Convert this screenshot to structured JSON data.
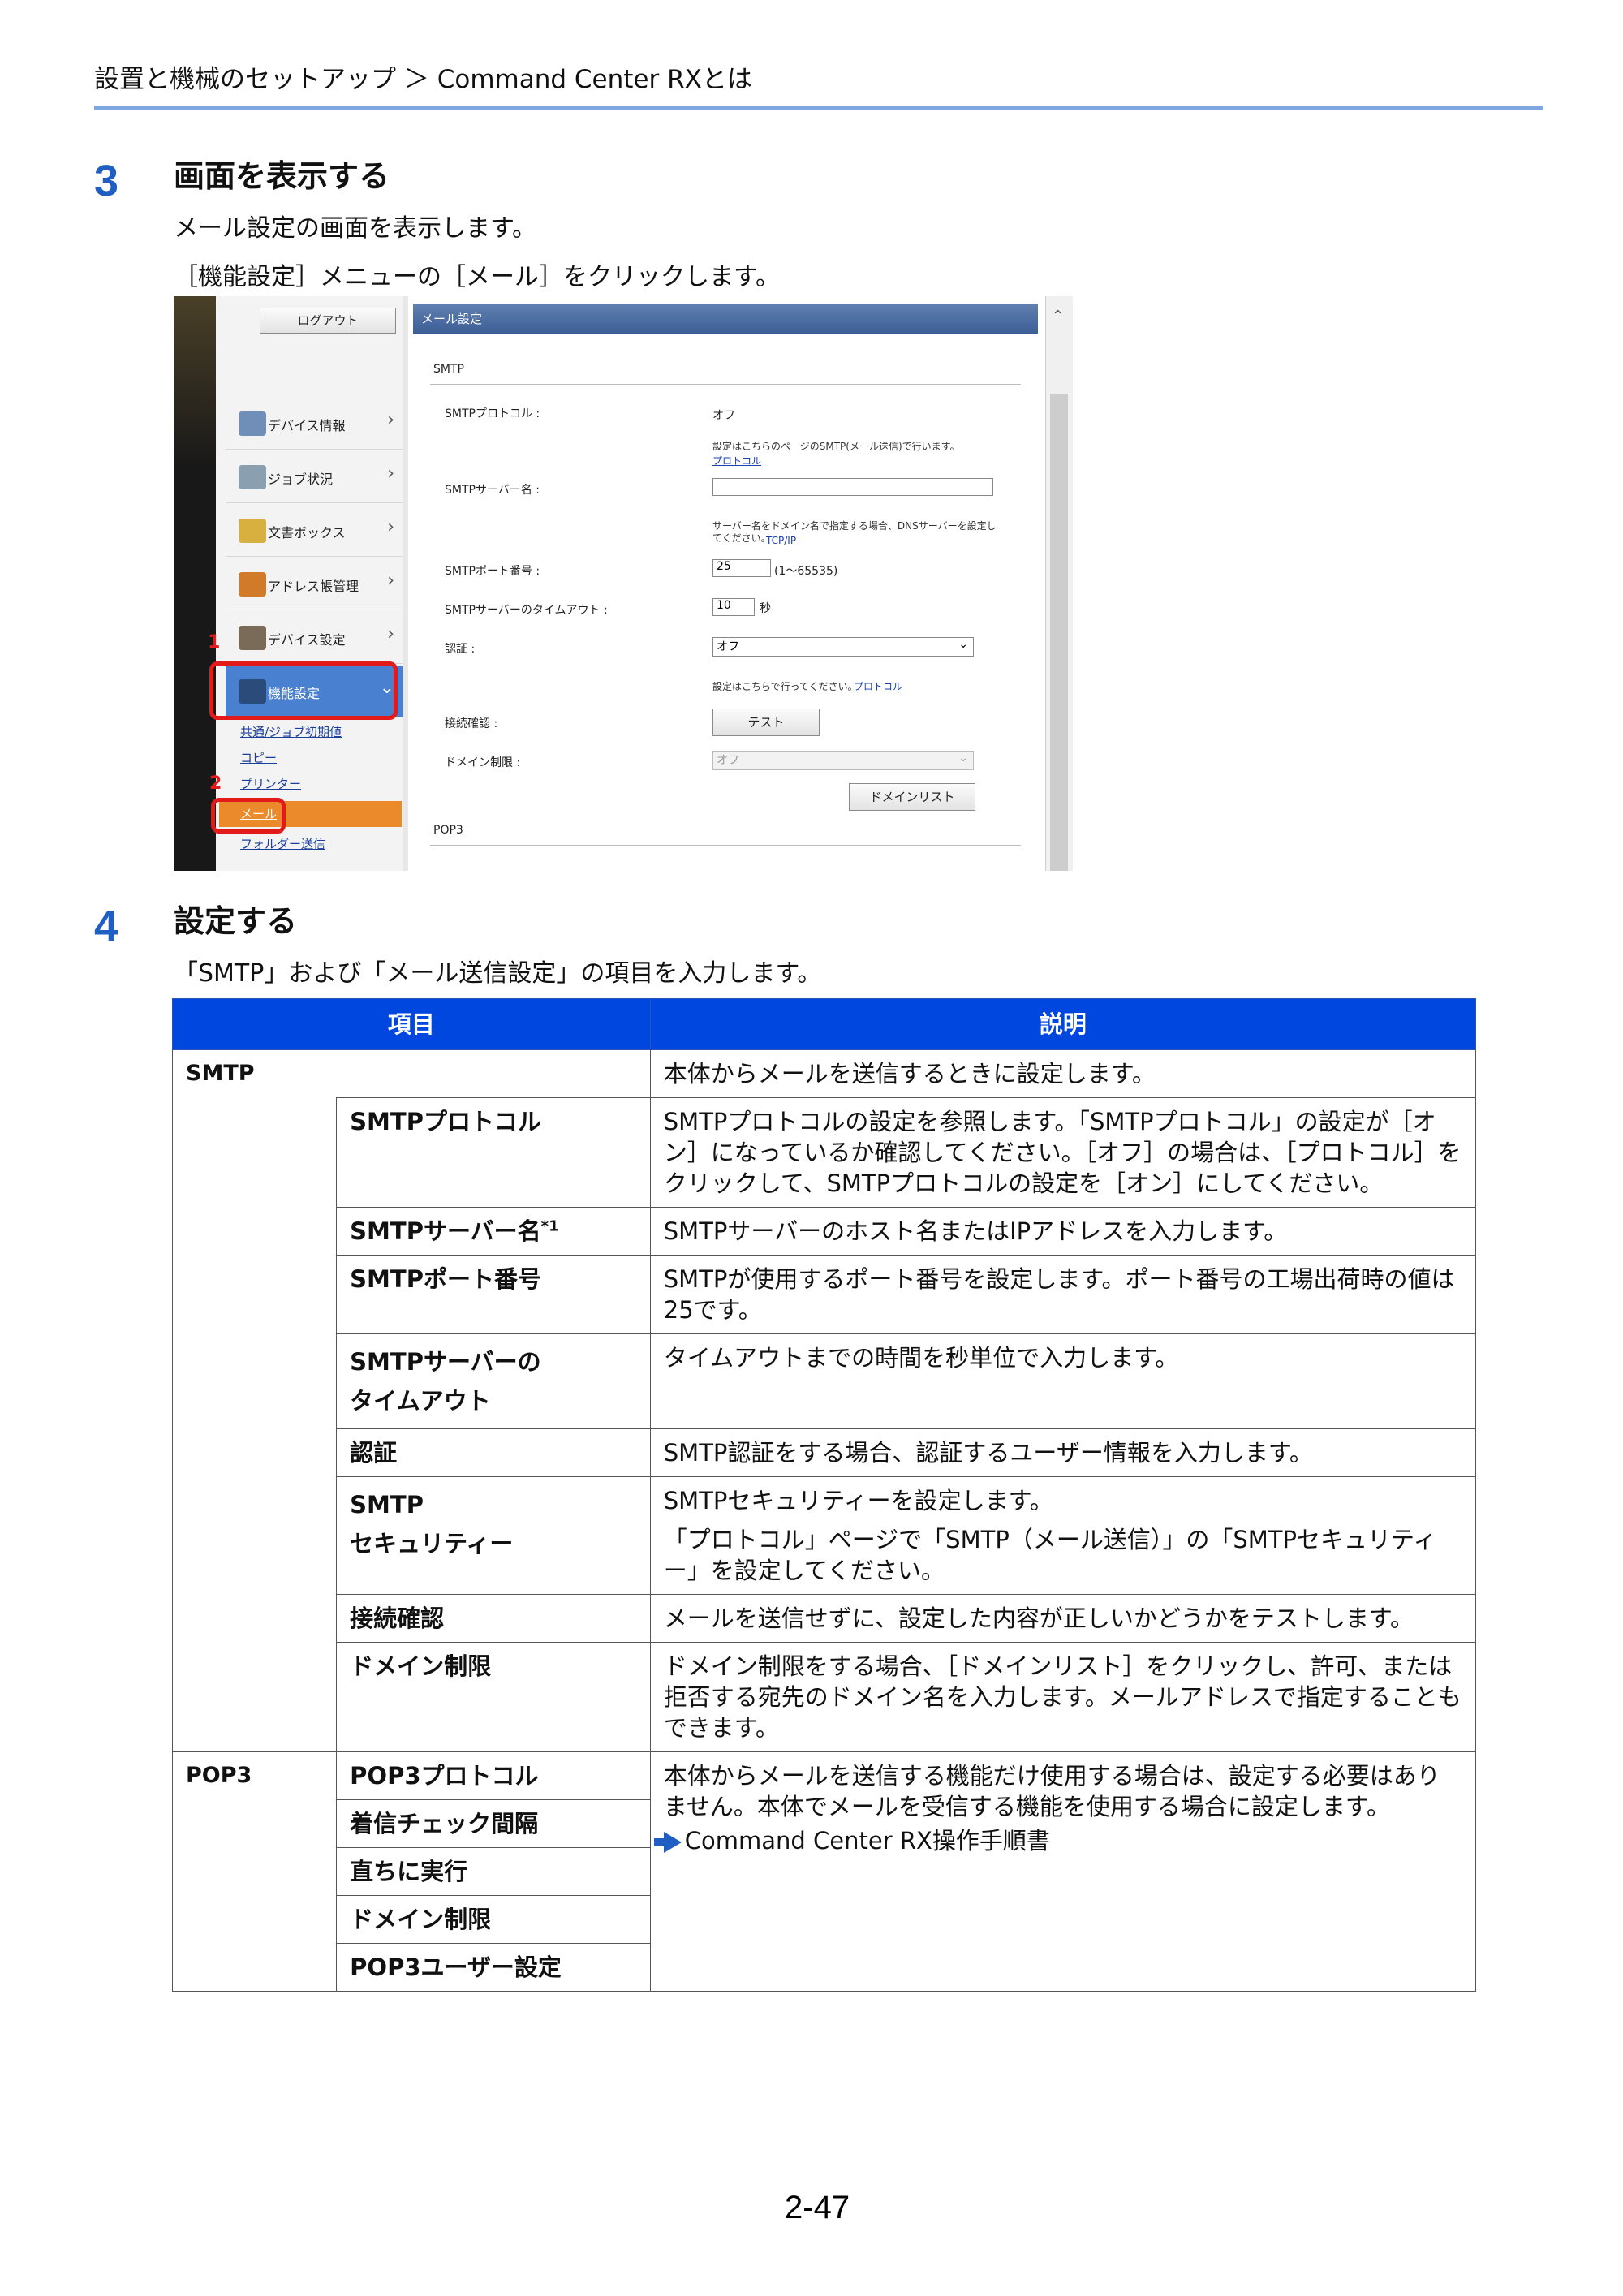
{
  "breadcrumb": "設置と機械のセットアップ ＞ Command Center RXとは",
  "step3": {
    "number": "3",
    "title": "画面を表示する",
    "line1": "メール設定の画面を表示します。",
    "line2": "［機能設定］メニューの［メール］をクリックします。"
  },
  "screenshot": {
    "logout_button": "ログアウト",
    "sidebar_items": [
      "デバイス情報",
      "ジョブ状況",
      "文書ボックス",
      "アドレス帳管理",
      "デバイス設定",
      "機能設定"
    ],
    "submenu_links": [
      "共通/ジョブ初期値",
      "コピー",
      "プリンター",
      "メール",
      "フォルダー送信"
    ],
    "callout_1": "1",
    "callout_2": "2",
    "panel_title": "メール設定",
    "section_smtp": "SMTP",
    "smtp_protocol_label": "SMTPプロトコル :",
    "smtp_protocol_value": "オフ",
    "smtp_protocol_note": "設定はこちらのページのSMTP(メール送信)で行います。",
    "smtp_protocol_link": "プロトコル",
    "smtp_server_label": "SMTPサーバー名 :",
    "smtp_server_note": "サーバー名をドメイン名で指定する場合、DNSサーバーを設定してください。",
    "smtp_server_link": "TCP/IP",
    "smtp_port_label": "SMTPポート番号 :",
    "smtp_port_value": "25",
    "smtp_port_range": "(1～65535)",
    "smtp_timeout_label": "SMTPサーバーのタイムアウト :",
    "smtp_timeout_value": "10",
    "smtp_timeout_unit": "秒",
    "auth_label": "認証 :",
    "auth_value": "オフ",
    "auth_note": "設定はこちらで行ってください。",
    "auth_link": "プロトコル",
    "conn_test_label": "接続確認 :",
    "test_button": "テスト",
    "domain_limit_label": "ドメイン制限 :",
    "domain_limit_value": "オフ",
    "domain_list_button": "ドメインリスト",
    "section_pop3": "POP3"
  },
  "step4": {
    "number": "4",
    "title": "設定する",
    "line1": "「SMTP」および「メール送信設定」の項目を入力します。"
  },
  "table": {
    "header_item": "項目",
    "header_desc": "説明",
    "smtp_group": "SMTP",
    "smtp_group_desc": "本体からメールを送信するときに設定します。",
    "rows": [
      {
        "name": "SMTPプロトコル",
        "desc": "SMTPプロトコルの設定を参照します。「SMTPプロトコル」の設定が［オン］になっているか確認してください。［オフ］の場合は、［プロトコル］をクリックして、SMTPプロトコルの設定を［オン］にしてください。"
      },
      {
        "name": "SMTPサーバー名",
        "sup": "*1",
        "desc": "SMTPサーバーのホスト名またはIPアドレスを入力します。"
      },
      {
        "name": "SMTPポート番号",
        "desc": "SMTPが使用するポート番号を設定します。ポート番号の工場出荷時の値は25です。"
      },
      {
        "name_l1": "SMTPサーバーの",
        "name_l2": "タイムアウト",
        "desc": "タイムアウトまでの時間を秒単位で入力します。"
      },
      {
        "name": "認証",
        "desc": "SMTP認証をする場合、認証するユーザー情報を入力します。"
      },
      {
        "name_l1": "SMTP",
        "name_l2": "セキュリティー",
        "desc_l1": "SMTPセキュリティーを設定します。",
        "desc_l2": "「プロトコル」ページで「SMTP（メール送信）」の「SMTPセキュリティー」を設定してください。"
      },
      {
        "name": "接続確認",
        "desc": "メールを送信せずに、設定した内容が正しいかどうかをテストします。"
      },
      {
        "name": "ドメイン制限",
        "desc": "ドメイン制限をする場合、［ドメインリスト］をクリックし、許可、または拒否する宛先のドメイン名を入力します。メールアドレスで指定することもできます。"
      }
    ],
    "pop3_group": "POP3",
    "pop3_rows": [
      "POP3プロトコル",
      "着信チェック間隔",
      "直ちに実行",
      "ドメイン制限",
      "POP3ユーザー設定"
    ],
    "pop3_desc": "本体からメールを送信する機能だけ使用する場合は、設定する必要はありません。本体でメールを受信する機能を使用する場合に設定します。",
    "pop3_ref": "Command Center RX操作手順書"
  },
  "page_number": "2-47"
}
